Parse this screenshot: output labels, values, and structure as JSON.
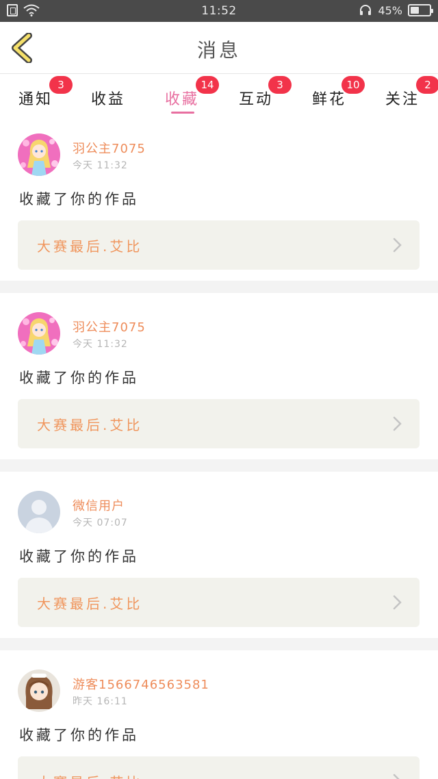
{
  "status_bar": {
    "time": "11:52",
    "battery_text": "45%",
    "battery_level": 0.45,
    "icons": [
      "sim-card-icon",
      "wifi-icon",
      "headset-icon",
      "battery-icon"
    ]
  },
  "header": {
    "title": "消息",
    "back_icon": "back-chevron-icon"
  },
  "tabs": [
    {
      "label": "通知",
      "badge": "3"
    },
    {
      "label": "收益",
      "badge": ""
    },
    {
      "label": "收藏",
      "badge": "14",
      "active": true
    },
    {
      "label": "互动",
      "badge": "3"
    },
    {
      "label": "鲜花",
      "badge": "10"
    },
    {
      "label": "关注",
      "badge": "2"
    }
  ],
  "colors": {
    "accent": "#e86fa0",
    "badge": "#f2334a",
    "username": "#ee8c5a",
    "work_title": "#f0955c",
    "work_box_bg": "#f2f2ec"
  },
  "notifications": [
    {
      "username": "羽公主7075",
      "time": "今天 11:32",
      "message": "收藏了你的作品",
      "work_title": "大赛最后.艾比",
      "avatar": "anime-princess-avatar"
    },
    {
      "username": "羽公主7075",
      "time": "今天 11:32",
      "message": "收藏了你的作品",
      "work_title": "大赛最后.艾比",
      "avatar": "anime-princess-avatar"
    },
    {
      "username": "微信用户",
      "time": "今天 07:07",
      "message": "收藏了你的作品",
      "work_title": "大赛最后.艾比",
      "avatar": "default-user-avatar"
    },
    {
      "username": "游客1566746563581",
      "time": "昨天 16:11",
      "message": "收藏了你的作品",
      "work_title": "大赛最后.艾比",
      "avatar": "anime-girl-avatar"
    }
  ]
}
